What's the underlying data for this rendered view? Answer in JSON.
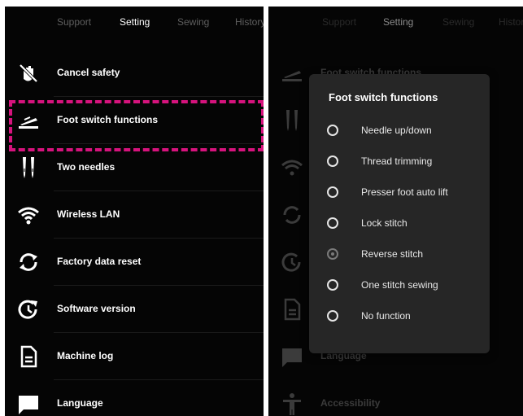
{
  "tabs": [
    {
      "label": "Support"
    },
    {
      "label": "Setting"
    },
    {
      "label": "Sewing"
    },
    {
      "label": "History"
    }
  ],
  "active_tab": "Setting",
  "menu": {
    "items": [
      {
        "label": "Cancel safety",
        "icon": "hand-slash-icon"
      },
      {
        "label": "Foot switch functions",
        "icon": "foot-pedal-icon"
      },
      {
        "label": "Two needles",
        "icon": "two-needles-icon"
      },
      {
        "label": "Wireless LAN",
        "icon": "wifi-icon"
      },
      {
        "label": "Factory data reset",
        "icon": "reset-arrows-icon"
      },
      {
        "label": "Software version",
        "icon": "update-clock-icon"
      },
      {
        "label": "Machine log",
        "icon": "document-icon"
      },
      {
        "label": "Language",
        "icon": "chat-bubble-icon"
      },
      {
        "label": "Accessibility",
        "icon": "accessibility-icon"
      }
    ]
  },
  "highlighted_item": "Foot switch functions",
  "dialog": {
    "title": "Foot switch functions",
    "options": [
      {
        "label": "Needle up/down",
        "selected": false
      },
      {
        "label": "Thread trimming",
        "selected": false
      },
      {
        "label": "Presser foot auto lift",
        "selected": false
      },
      {
        "label": "Lock stitch",
        "selected": false
      },
      {
        "label": "Reverse stitch",
        "selected": true
      },
      {
        "label": "One stitch sewing",
        "selected": false
      },
      {
        "label": "No function",
        "selected": false
      }
    ]
  },
  "colors": {
    "background": "#050505",
    "dialog_background": "#262626",
    "highlight": "#d6137d",
    "text": "#ffffff",
    "inactive_tab": "#5f5f5f"
  }
}
